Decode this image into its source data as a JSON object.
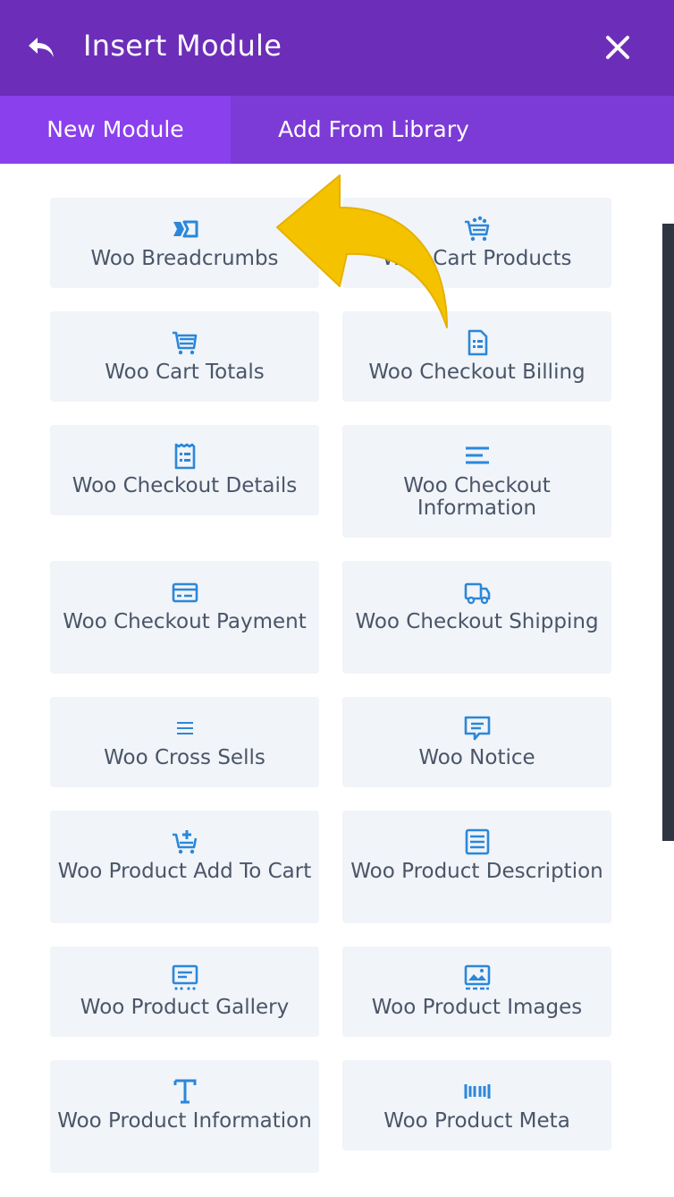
{
  "header": {
    "title": "Insert Module",
    "back_icon": "undo-arrow-icon",
    "close_icon": "close-icon",
    "background": "#6c2eb9"
  },
  "tabs": [
    {
      "label": "New Module",
      "active": true
    },
    {
      "label": "Add From Library",
      "active": false
    }
  ],
  "accent_color": "#2b87da",
  "callout_color": "#f5c200",
  "modules": [
    {
      "label": "Woo Breadcrumbs",
      "icon": "breadcrumbs-icon"
    },
    {
      "label": "Woo Cart Products",
      "icon": "cart-products-icon"
    },
    {
      "label": "Woo Cart Totals",
      "icon": "cart-totals-icon"
    },
    {
      "label": "Woo Checkout Billing",
      "icon": "checkout-billing-icon"
    },
    {
      "label": "Woo Checkout Details",
      "icon": "checkout-details-icon"
    },
    {
      "label": "Woo Checkout Information",
      "icon": "checkout-information-icon"
    },
    {
      "label": "Woo Checkout Payment",
      "icon": "checkout-payment-icon"
    },
    {
      "label": "Woo Checkout Shipping",
      "icon": "checkout-shipping-icon"
    },
    {
      "label": "Woo Cross Sells",
      "icon": "cross-sells-icon"
    },
    {
      "label": "Woo Notice",
      "icon": "notice-icon"
    },
    {
      "label": "Woo Product Add To Cart",
      "icon": "add-to-cart-icon"
    },
    {
      "label": "Woo Product Description",
      "icon": "product-description-icon"
    },
    {
      "label": "Woo Product Gallery",
      "icon": "product-gallery-icon"
    },
    {
      "label": "Woo Product Images",
      "icon": "product-images-icon"
    },
    {
      "label": "Woo Product Information",
      "icon": "product-information-icon"
    },
    {
      "label": "Woo Product Meta",
      "icon": "product-meta-icon"
    }
  ]
}
